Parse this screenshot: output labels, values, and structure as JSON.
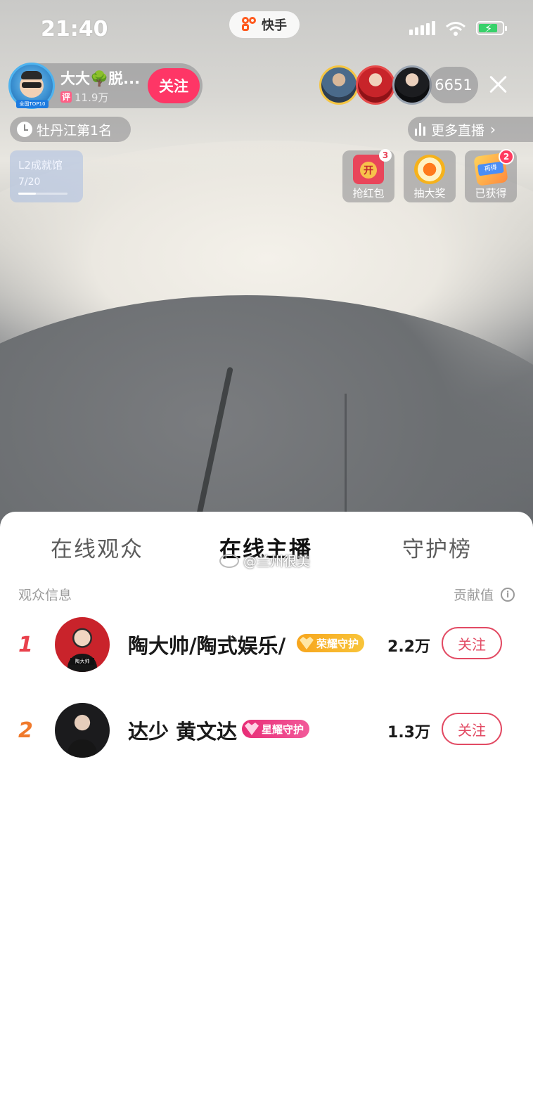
{
  "status_bar": {
    "time": "21:40",
    "app_name": "快手"
  },
  "host": {
    "name": "大大🌳脱...",
    "badge": "评",
    "fans": "11.9万",
    "avatar_badge": "全国TOP10",
    "follow_label": "关注"
  },
  "viewers": {
    "count": "6651"
  },
  "rank": {
    "label": "牡丹江第1名"
  },
  "more_live": {
    "label": "更多直播"
  },
  "level_card": {
    "title": "L2成就馆",
    "progress_text": "7/20",
    "progress_fraction": 0.35
  },
  "widgets": [
    {
      "label": "抢红包",
      "badge": "3",
      "art_text": "开"
    },
    {
      "label": "抽大奖"
    },
    {
      "label": "已获得",
      "badge": "2",
      "art_text": "再得"
    }
  ],
  "tabs": [
    "在线观众",
    "在线主播",
    "守护榜"
  ],
  "active_tab": "在线主播",
  "watermark": "@兰州很美",
  "list_header": {
    "left": "观众信息",
    "right": "贡献值"
  },
  "rows": [
    {
      "rank": "1",
      "name": "陶大帅/陶式娱乐/",
      "badge": "荣耀守护",
      "value": "2.2万",
      "follow": "关注",
      "plate": "陶大帅"
    },
    {
      "rank": "2",
      "name": "达少 黄文达",
      "badge": "星耀守护",
      "value": "1.3万",
      "follow": "关注"
    }
  ],
  "colors": {
    "accent": "#fe3666",
    "follow_outline": "#e24a63",
    "rank1": "#e9414c",
    "rank2": "#f07a2c"
  }
}
